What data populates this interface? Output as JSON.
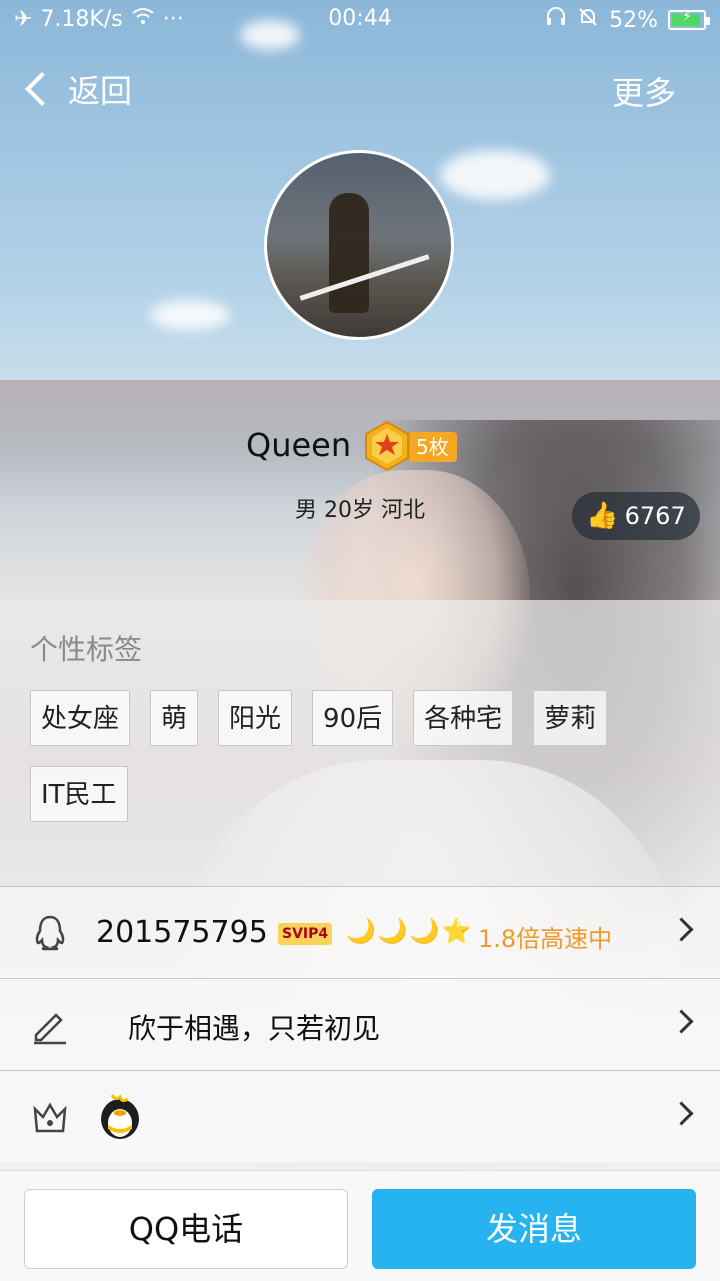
{
  "status_bar": {
    "speed": "7.18K/s",
    "time": "00:44",
    "battery": "52%",
    "icons": [
      "airplane-icon",
      "wifi-icon",
      "more-dots-icon",
      "headset-icon",
      "mute-bell-icon",
      "battery-charging-icon"
    ]
  },
  "nav": {
    "back_label": "返回",
    "more_label": "更多"
  },
  "profile": {
    "name": "Queen",
    "medal_count": "5枚",
    "info": "男 20岁 河北",
    "likes": "6767"
  },
  "tags": {
    "title": "个性标签",
    "items": [
      "处女座",
      "萌",
      "阳光",
      "90后",
      "各种宅",
      "萝莉",
      "IT民工"
    ]
  },
  "list": {
    "qq_number": "201575795",
    "svip_label": "SVIP4",
    "level_icons": "🌙🌙🌙⭐",
    "speed_text": "1.8倍高速中",
    "signature": "欣于相遇，只若初见"
  },
  "buttons": {
    "call": "QQ电话",
    "message": "发消息"
  },
  "colors": {
    "accent": "#27b3f0",
    "speed": "#f09a2a",
    "medal": "#f5a623"
  }
}
